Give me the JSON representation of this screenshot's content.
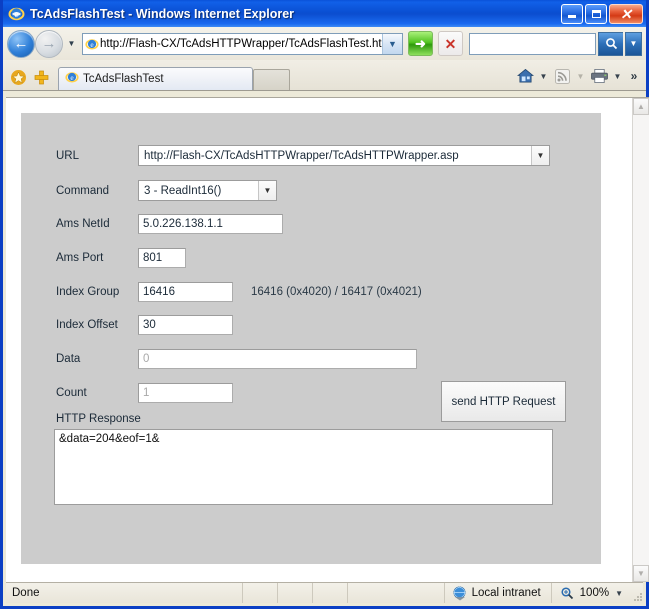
{
  "window": {
    "title": "TcAdsFlashTest - Windows Internet Explorer",
    "minimize_label": "",
    "maximize_label": "",
    "close_label": "✕"
  },
  "nav": {
    "back_glyph": "←",
    "forward_glyph": "→",
    "history_caret": "▼",
    "address_value": "http://Flash-CX/TcAdsHTTPWrapper/TcAdsFlashTest.htm",
    "address_caret": "▼",
    "go_glyph": "➜",
    "stop_glyph": "✕",
    "search_value": "",
    "search_placeholder": "",
    "search_caret": "▼"
  },
  "tabs": {
    "active": "TcAdsFlashTest",
    "new_tab_label": "",
    "home_caret": "▼",
    "feeds_caret": "▼",
    "print_caret": "▼",
    "overflow_glyph": "»"
  },
  "form": {
    "fields": [
      {
        "label": "URL",
        "value": "http://Flash-CX/TcAdsHTTPWrapper/TcAdsHTTPWrapper.asp"
      },
      {
        "label": "Command",
        "value": "3 - ReadInt16()"
      },
      {
        "label": "Ams NetId",
        "value": "5.0.226.138.1.1"
      },
      {
        "label": "Ams Port",
        "value": "801"
      },
      {
        "label": "Index Group",
        "value": "16416",
        "hint": "16416 (0x4020) / 16417 (0x4021)"
      },
      {
        "label": "Index Offset",
        "value": "30"
      },
      {
        "label": "Data",
        "value": "0"
      },
      {
        "label": "Count",
        "value": "1"
      }
    ],
    "send_button": "send HTTP Request",
    "response_label": "HTTP Response",
    "response_value": "&data=204&eof=1&",
    "combo_caret": "▼"
  },
  "scrollbar": {
    "up_glyph": "▲",
    "down_glyph": "▼"
  },
  "status": {
    "message": "Done",
    "zone": "Local intranet",
    "zoom": "100%",
    "zoom_caret": "▼"
  },
  "colors": {
    "title_blue": "#0b3fc4",
    "panel_gray": "#cccccc",
    "chrome": "#edeae0"
  }
}
